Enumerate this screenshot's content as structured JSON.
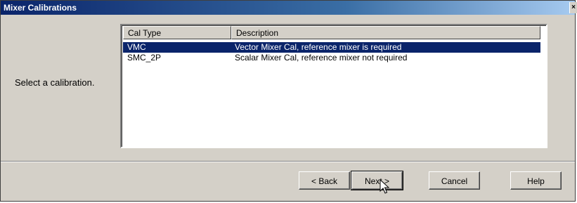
{
  "window": {
    "title": "Mixer Calibrations",
    "close_glyph": "×"
  },
  "prompt": "Select a calibration.",
  "list": {
    "columns": [
      "Cal Type",
      "Description"
    ],
    "rows": [
      {
        "type": "VMC",
        "description": "Vector Mixer Cal, reference mixer is required",
        "selected": true
      },
      {
        "type": "SMC_2P",
        "description": "Scalar Mixer Cal, reference mixer not required",
        "selected": false
      }
    ]
  },
  "buttons": {
    "back": "< Back",
    "next": "Next >",
    "cancel": "Cancel",
    "help": "Help"
  },
  "colors": {
    "title_bar": "#0a246a",
    "selection": "#0a246a",
    "face": "#d4d0c8"
  },
  "icons": {
    "cursor": "mouse-pointer-icon"
  }
}
